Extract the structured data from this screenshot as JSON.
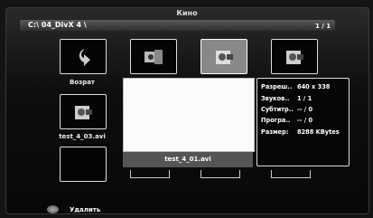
{
  "window": {
    "title": "Кино"
  },
  "path": {
    "current": "C:\\ 04_DivX 4 \\",
    "page": "1 / 1"
  },
  "grid": {
    "back_label": "Возрат",
    "file_label": "test_4_03.avi"
  },
  "preview": {
    "filename": "test_4_01.avi"
  },
  "info": {
    "rows": [
      {
        "key": "Разреш..",
        "value": "640 x  338"
      },
      {
        "key": "Звуков..",
        "value": "1 / 1"
      },
      {
        "key": "Субтитр..",
        "value": "-- / 0"
      },
      {
        "key": "Програ..",
        "value": "-- / 0"
      },
      {
        "key": "Размер:",
        "value": "8288 KBytes"
      }
    ]
  },
  "footer": {
    "delete_label": "Удалить",
    "accent": "#888888"
  }
}
